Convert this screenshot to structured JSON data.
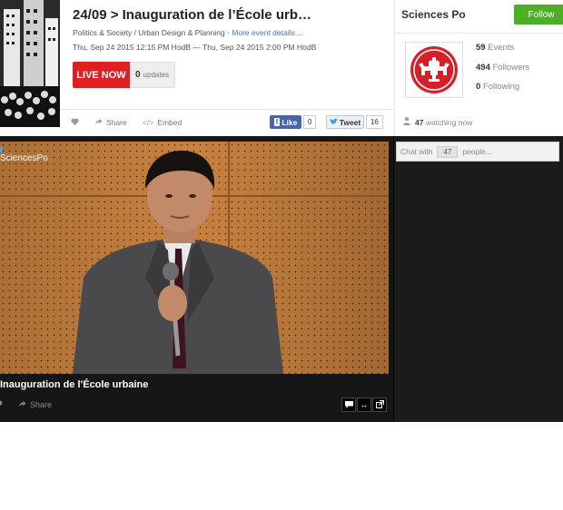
{
  "event": {
    "title": "24/09 > Inauguration de l’École urb…",
    "categories": "Politics & Society / Urban Design & Planning ·",
    "more_details": "More event details ...",
    "time": "Thu, Sep 24 2015 12:15 PM HodB — Thu, Sep 24 2015 2:00 PM HodB",
    "live_label": "LIVE NOW",
    "updates_count": "0",
    "updates_label": "updates"
  },
  "actions": {
    "share_label": "Share",
    "embed_label": "Embed",
    "like_label": "Like",
    "like_count": "0",
    "tweet_label": "Tweet",
    "tweet_count": "16"
  },
  "org": {
    "name": "Sciences Po",
    "follow_label": "Follow",
    "events_count": "59",
    "events_label": "Events",
    "followers_count": "494",
    "followers_label": "Followers",
    "following_count": "0",
    "following_label": "Following",
    "watching_count": "47",
    "watching_label": "watching now"
  },
  "player": {
    "watermark": "SciencesPo",
    "title": "Inauguration de l'École urbaine",
    "share_label": "Share"
  },
  "chat": {
    "prefix": "Chat with",
    "count": "47",
    "suffix": "people..."
  },
  "colors": {
    "live_red": "#e02020",
    "follow_green": "#4caf26",
    "facebook_blue": "#4a66a8",
    "link_blue": "#3b78c4",
    "stage_dark": "#161616",
    "wall_orange": "#c9823f"
  }
}
